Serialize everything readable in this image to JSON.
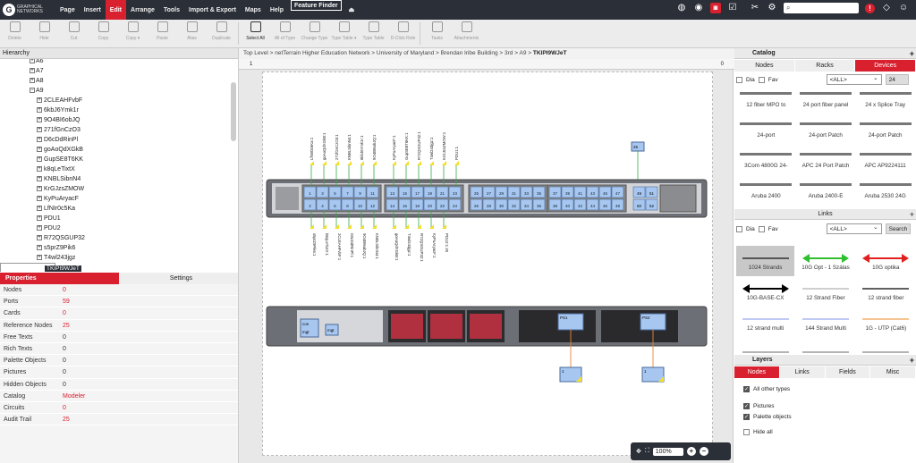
{
  "menubar": {
    "logo_text": "GRAPHICAL NETWORKS",
    "items": [
      "Page",
      "Insert",
      "Edit",
      "Arrange",
      "Tools",
      "Import & Export",
      "Maps",
      "Help"
    ],
    "active": "Edit",
    "feature_finder": "Feature Finder",
    "search_placeholder": "",
    "alert_count": "!"
  },
  "toolbar": {
    "tools": [
      {
        "label": "Delete",
        "icon": "trash-icon",
        "enabled": false
      },
      {
        "label": "Hide",
        "icon": "eye-icon",
        "enabled": false
      },
      {
        "label": "Cut",
        "icon": "scissors-icon",
        "enabled": false
      },
      {
        "label": "Copy",
        "icon": "copy-icon",
        "enabled": false
      },
      {
        "label": "Copy ▾",
        "icon": "copy-menu-icon",
        "enabled": false
      },
      {
        "label": "Paste",
        "icon": "paste-icon",
        "enabled": false
      },
      {
        "label": "Alias",
        "icon": "alias-icon",
        "enabled": false
      },
      {
        "label": "Duplicate",
        "icon": "duplicate-icon",
        "enabled": false
      },
      {
        "label": "Select All",
        "icon": "select-all-icon",
        "enabled": true
      },
      {
        "label": "All of Type",
        "icon": "all-of-type-icon",
        "enabled": false
      },
      {
        "label": "Change Type",
        "icon": "change-type-icon",
        "enabled": false
      },
      {
        "label": "Type Table ▾",
        "icon": "type-table-icon",
        "enabled": false
      },
      {
        "label": "Type Table",
        "icon": "type-table-2-icon",
        "enabled": false
      },
      {
        "label": "D-Click Role",
        "icon": "dclick-role-icon",
        "enabled": false
      },
      {
        "label": "Tasks",
        "icon": "tasks-icon",
        "enabled": false
      },
      {
        "label": "Attachments",
        "icon": "attachments-icon",
        "enabled": false
      }
    ]
  },
  "hierarchy": {
    "title": "Hierarchy",
    "rows": [
      {
        "label": "A6",
        "level": 0,
        "toggle": "+"
      },
      {
        "label": "A7",
        "level": 0,
        "toggle": "+"
      },
      {
        "label": "A8",
        "level": 0,
        "toggle": "+"
      },
      {
        "label": "A9",
        "level": 0,
        "toggle": "−"
      },
      {
        "label": "2CLEAHFvbF",
        "level": 1,
        "toggle": "+"
      },
      {
        "label": "6kbJ6Ymk1r",
        "level": 1,
        "toggle": "+"
      },
      {
        "label": "9O4BI6obJQ",
        "level": 1,
        "toggle": "+"
      },
      {
        "label": "271fGnCzO3",
        "level": 1,
        "toggle": "+"
      },
      {
        "label": "D6cDdRinPl",
        "level": 1,
        "toggle": "+"
      },
      {
        "label": "goAoQdXGkB",
        "level": 1,
        "toggle": "+"
      },
      {
        "label": "GupSE8T6KK",
        "level": 1,
        "toggle": "+"
      },
      {
        "label": "k8qLeTixtX",
        "level": 1,
        "toggle": "+"
      },
      {
        "label": "KNBLSibnN4",
        "level": 1,
        "toggle": "+"
      },
      {
        "label": "KrGJzsZMOW",
        "level": 1,
        "toggle": "+"
      },
      {
        "label": "KyPuAryacF",
        "level": 1,
        "toggle": "+"
      },
      {
        "label": "LfNIr0c5Ka",
        "level": 1,
        "toggle": "+"
      },
      {
        "label": "PDU1",
        "level": 1,
        "toggle": "+"
      },
      {
        "label": "PDU2",
        "level": 1,
        "toggle": "+"
      },
      {
        "label": "R72QSGUP32",
        "level": 1,
        "toggle": "+"
      },
      {
        "label": "s5prZ9Pik6",
        "level": 1,
        "toggle": "+"
      },
      {
        "label": "T4wl243jgz",
        "level": 1,
        "toggle": "+"
      },
      {
        "label": "TKIPI9WJeT",
        "level": 1,
        "toggle": "",
        "selected": true
      }
    ]
  },
  "properties": {
    "tab_properties": "Properties",
    "tab_settings": "Settings",
    "rows": [
      {
        "k": "Nodes",
        "v": "0",
        "red": true
      },
      {
        "k": "Ports",
        "v": "59",
        "red": true
      },
      {
        "k": "Cards",
        "v": "0",
        "red": true
      },
      {
        "k": "Reference Nodes",
        "v": "25",
        "red": true
      },
      {
        "k": "Free Texts",
        "v": "0",
        "red": false
      },
      {
        "k": "Rich Texts",
        "v": "0",
        "red": false
      },
      {
        "k": "Palette Objects",
        "v": "0",
        "red": false
      },
      {
        "k": "Pictures",
        "v": "0",
        "red": false
      },
      {
        "k": "Hidden Objects",
        "v": "0",
        "red": false
      },
      {
        "k": "Catalog",
        "v": "Modeler",
        "red": true
      },
      {
        "k": "Circuits",
        "v": "0",
        "red": true
      },
      {
        "k": "Audit Trail",
        "v": "25",
        "red": true
      }
    ]
  },
  "canvas": {
    "breadcrumb": [
      "Top Level",
      "netTerrain Higher Education Network",
      "University of Maryland",
      "Brendan Iribe Building",
      "3rd",
      "A9"
    ],
    "current": "TKIPI9WJeT",
    "ruler_left": "1",
    "ruler_right": "0",
    "zoom": "100%",
    "top_labels": [
      "LfNIr0c5Ka:1",
      "goAoQdXGkB:1",
      "271fGnCzO3:1",
      "KNBLSibnN4:1",
      "6kbJ6Ymk1r:1",
      "9O4BI6obJQ:1",
      "KyPuAryacF:1",
      "GupSE8T6KK:1",
      "R72QSGUP32:1",
      "T4wl243jgz:1",
      "KrGJzsZMOW:1",
      "PDU1:1"
    ],
    "bottom_labels": [
      "s5prZ9Pik6:1",
      "k8qLeTixtX:1",
      "2CLEAHFvbF:1",
      "D6cDdRinPl:1",
      "9O4BI6obJQ:1",
      "KNBLSibnN4:1",
      "goAoQdXGkB:1",
      "T4wl243jgz:1",
      "R72QSGUP32:1",
      "KyPuAryacF:1",
      "PDU2:1 25"
    ],
    "port_numbers_top": [
      "1",
      "3",
      "5",
      "7",
      "9",
      "11",
      "13",
      "15",
      "17",
      "19",
      "21",
      "23",
      "25",
      "27",
      "29",
      "31",
      "33",
      "35",
      "37",
      "39",
      "41",
      "43",
      "45",
      "47",
      "49",
      "51"
    ],
    "port_numbers_bottom": [
      "2",
      "4",
      "6",
      "8",
      "10",
      "12",
      "14",
      "16",
      "18",
      "20",
      "22",
      "24",
      "26",
      "28",
      "30",
      "32",
      "34",
      "36",
      "38",
      "40",
      "42",
      "44",
      "46",
      "48",
      "50",
      "52"
    ],
    "ps_labels": [
      "PS1",
      "PS2"
    ],
    "mgmt_labels": [
      "con",
      "mgt",
      "mgt"
    ],
    "ref_labels": [
      "25",
      "1",
      "1"
    ]
  },
  "catalog": {
    "title": "Catalog",
    "tabs": [
      "Nodes",
      "Racks",
      "Devices"
    ],
    "active_tab": "Devices",
    "dia": "Dia",
    "fav": "Fav",
    "filter": "<ALL>",
    "count": "24",
    "items": [
      "12 fiber MPO to",
      "24 port fiber panel",
      "24 x Splice Tray",
      "24-port",
      "24-port Patch",
      "24-port Patch",
      "3Com 4800G 24-",
      "APC 24 Port Patch",
      "APC AP9224111",
      "Aruba 2400",
      "Aruba 2400-E",
      "Aruba 2530 24G"
    ]
  },
  "links": {
    "title": "Links",
    "dia": "Dia",
    "fav": "Fav",
    "filter": "<ALL>",
    "search": "Search",
    "items": [
      {
        "label": "1024 Strands",
        "color": "#555555",
        "style": "line",
        "selected": true
      },
      {
        "label": "10G Opt - 1 Szálas",
        "color": "#2fbf2f",
        "style": "double-arrow",
        "selected": false
      },
      {
        "label": "10G optika",
        "color": "#e02020",
        "style": "double-arrow",
        "selected": false
      },
      {
        "label": "10G-BASE-CX",
        "color": "#000000",
        "style": "double-arrow",
        "selected": false
      },
      {
        "label": "12 Strand Fiber",
        "color": "#b0b0b0",
        "style": "line",
        "selected": false
      },
      {
        "label": "12 strand fiber",
        "color": "#000000",
        "style": "line",
        "selected": false
      },
      {
        "label": "12 strand multi",
        "color": "#99aaee",
        "style": "line",
        "selected": false
      },
      {
        "label": "144 Strand Multi",
        "color": "#99aaee",
        "style": "line",
        "selected": false
      },
      {
        "label": "1G - UTP (Cat6)",
        "color": "#f0a050",
        "style": "line",
        "selected": false
      },
      {
        "label": "",
        "color": "#888888",
        "style": "line",
        "selected": false
      },
      {
        "label": "",
        "color": "#888888",
        "style": "line",
        "selected": false
      },
      {
        "label": "",
        "color": "#888888",
        "style": "line",
        "selected": false
      }
    ]
  },
  "layers": {
    "title": "Layers",
    "tabs": [
      "Nodes",
      "Links",
      "Fields",
      "Misc"
    ],
    "active_tab": "Nodes",
    "items": [
      {
        "label": "All other types",
        "checked": true
      },
      {
        "label": "Pictures",
        "checked": true
      },
      {
        "label": "Palette objects",
        "checked": true
      },
      {
        "label": "Hide all",
        "checked": false
      }
    ]
  },
  "colors": {
    "accent": "#d8202f",
    "dark": "#2b2f38",
    "port": "#a7c7f0",
    "cable_green": "#3aa84a",
    "cable_orange": "#e8873a"
  }
}
